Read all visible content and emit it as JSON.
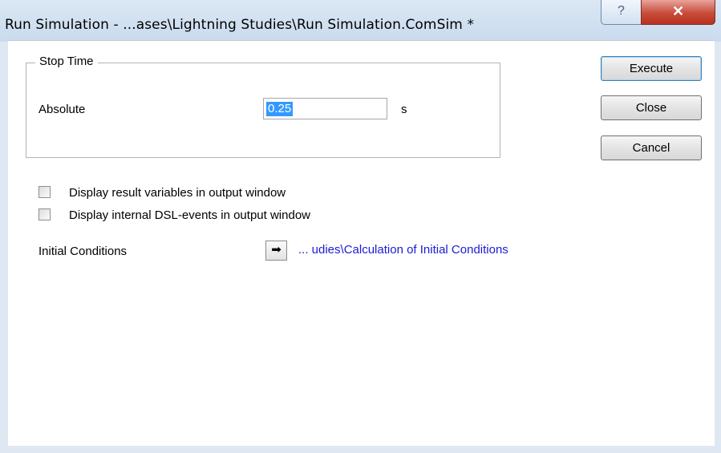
{
  "window": {
    "title": "Run Simulation - ...ases\\Lightning Studies\\Run Simulation.ComSim *",
    "help_glyph": "?",
    "close_glyph": "✕"
  },
  "stop_time": {
    "group_label": "Stop Time",
    "absolute_label": "Absolute",
    "absolute_value": "0.25",
    "unit": "s"
  },
  "buttons": {
    "execute": "Execute",
    "close": "Close",
    "cancel": "Cancel"
  },
  "options": [
    {
      "label": "Display result variables in output window",
      "checked": false
    },
    {
      "label": "Display internal DSL-events in output window",
      "checked": false
    }
  ],
  "initial_conditions": {
    "label": "Initial Conditions",
    "arrow_glyph": "➡",
    "link_text": "... udies\\Calculation of Initial Conditions"
  },
  "colors": {
    "link": "#1b1bd6",
    "selection": "#3399ff",
    "close_button": "#c74b3a"
  }
}
